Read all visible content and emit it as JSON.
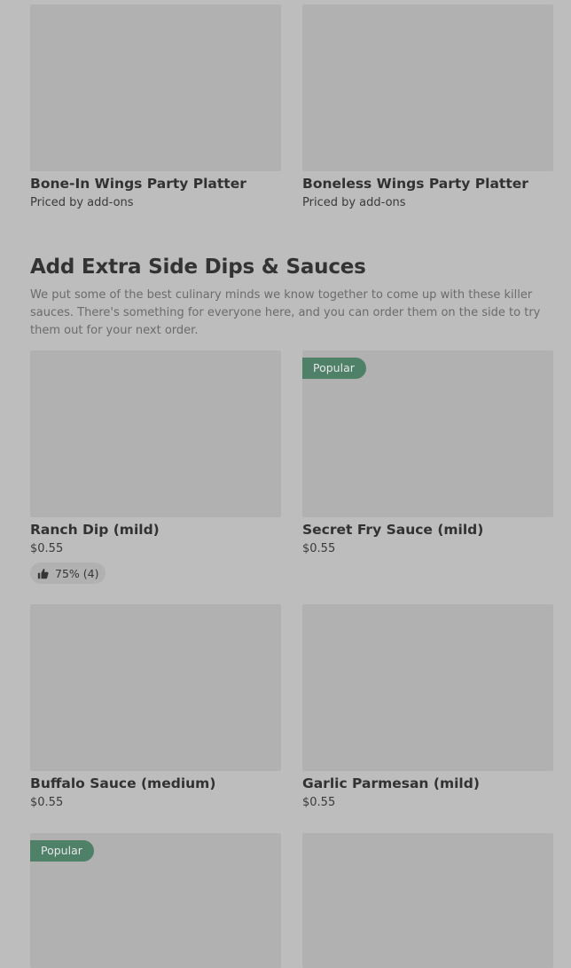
{
  "top_row": [
    {
      "name": "Bone-In Wings Party Platter",
      "subtitle": "Priced by add-ons"
    },
    {
      "name": "Boneless Wings Party Platter",
      "subtitle": "Priced by add-ons"
    }
  ],
  "section": {
    "title": "Add Extra Side Dips & Sauces",
    "description": "We put some of the best culinary minds we know together to come up with these killer sauces. There's something for everyone here, and you can order them on the side to try them out for your next order."
  },
  "items": [
    {
      "name": "Ranch Dip (mild)",
      "price": "$0.55",
      "rating": "75% (4)"
    },
    {
      "name": "Secret Fry Sauce (mild)",
      "price": "$0.55",
      "badge": "Popular"
    },
    {
      "name": "Buffalo Sauce (medium)",
      "price": "$0.55"
    },
    {
      "name": "Garlic Parmesan (mild)",
      "price": "$0.55"
    },
    {
      "badge": "Popular"
    }
  ],
  "icons": {
    "rating": "thumbs-up-icon"
  },
  "colors": {
    "background": "#bdbdbd",
    "image_placeholder": "#b1b1b1",
    "badge": "#4f8169"
  }
}
